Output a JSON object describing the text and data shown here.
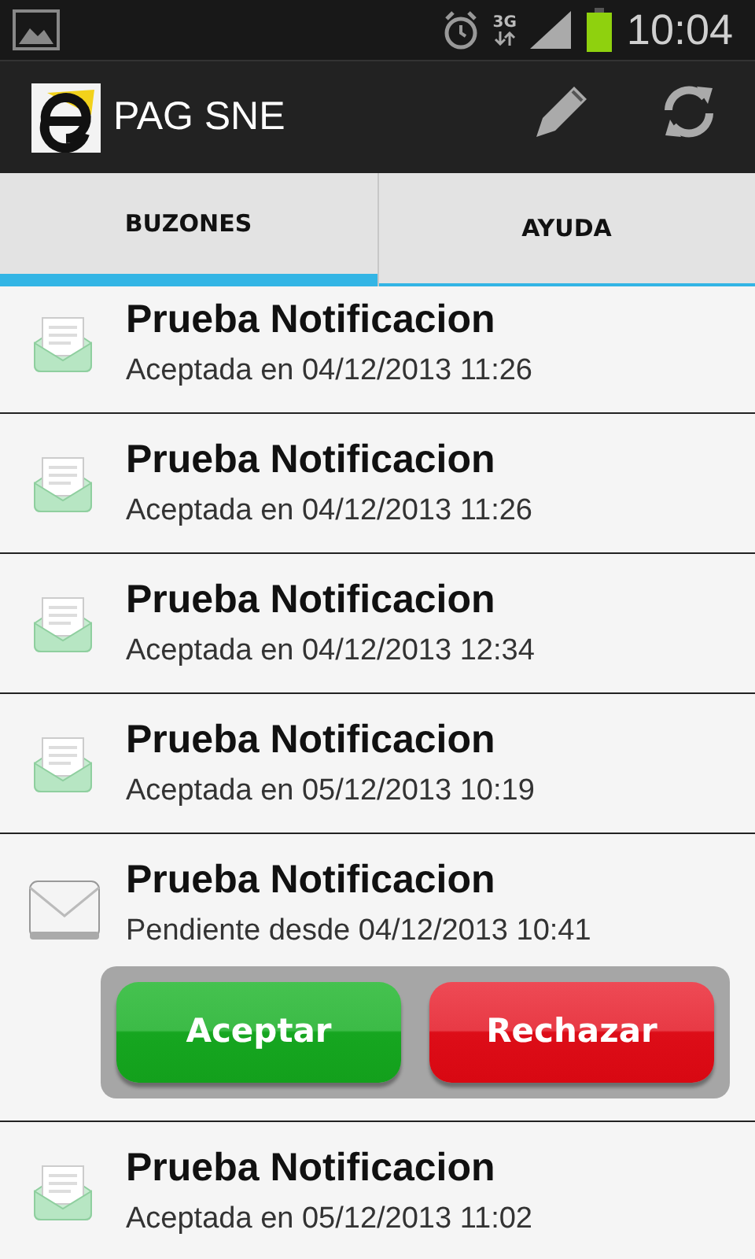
{
  "status_bar": {
    "time": "10:04",
    "network": "3G"
  },
  "action_bar": {
    "title": "PAG SNE"
  },
  "tabs": [
    {
      "label": "BUZONES",
      "selected": true
    },
    {
      "label": "AYUDA",
      "selected": false
    }
  ],
  "items": [
    {
      "title": "Prueba Notificacion",
      "subtitle": "Aceptada en 04/12/2013 11:26",
      "kind": "accepted"
    },
    {
      "title": "Prueba Notificacion",
      "subtitle": "Aceptada en 04/12/2013 11:26",
      "kind": "accepted"
    },
    {
      "title": "Prueba Notificacion",
      "subtitle": "Aceptada en 04/12/2013 12:34",
      "kind": "accepted"
    },
    {
      "title": "Prueba Notificacion",
      "subtitle": "Aceptada en 05/12/2013 10:19",
      "kind": "accepted"
    },
    {
      "title": "Prueba Notificacion",
      "subtitle": "Pendiente desde 04/12/2013 10:41",
      "kind": "pending",
      "actions": [
        {
          "label": "Aceptar",
          "kind": "accept"
        },
        {
          "label": "Rechazar",
          "kind": "reject"
        }
      ]
    },
    {
      "title": "Prueba Notificacion",
      "subtitle": "Aceptada en 05/12/2013 11:02",
      "kind": "accepted"
    }
  ]
}
